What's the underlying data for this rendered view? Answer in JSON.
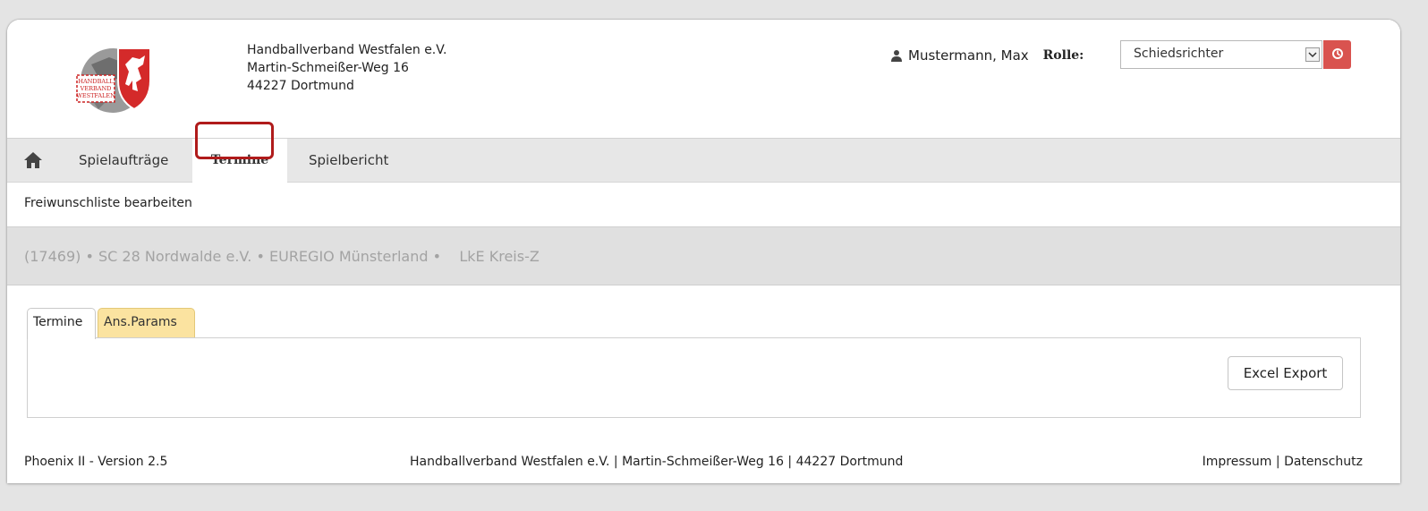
{
  "header": {
    "org_name": "Handballverband Westfalen e.V.",
    "street": "Martin-Schmeißer-Weg 16",
    "city": "44227 Dortmund",
    "logo_text": [
      "HANDBALL",
      "VERBAND",
      "WESTFALEN"
    ]
  },
  "user": {
    "name": "Mustermann, Max",
    "role_label": "Rolle:",
    "role_value": "Schiedsrichter"
  },
  "nav": {
    "items": [
      {
        "label": "Spielaufträge"
      },
      {
        "label": "Termine"
      },
      {
        "label": "Spielbericht"
      }
    ],
    "active": "Termine"
  },
  "subnav": {
    "link": "Freiwunschliste bearbeiten"
  },
  "infobar": {
    "text": "(17469) • SC 28 Nordwalde e.V. • EUREGIO Münsterland •    LkE Kreis-Z"
  },
  "tabs": [
    {
      "label": "Termine"
    },
    {
      "label": "Ans.Params"
    }
  ],
  "panel": {
    "excel_button": "Excel Export"
  },
  "footer": {
    "version": "Phoenix II - Version 2.5",
    "address": "Handballverband Westfalen e.V. | Martin-Schmeißer-Weg 16 | 44227 Dortmund",
    "impressum": "Impressum",
    "separator": "|",
    "datenschutz": "Datenschutz"
  },
  "colors": {
    "logout": "#d9534f",
    "highlight": "#b01b1b",
    "tab_params": "#fbe3a0"
  },
  "icons": {
    "user": "user-icon",
    "home": "home-icon",
    "logout": "power-icon",
    "dropdown": "chevron-down-icon"
  }
}
